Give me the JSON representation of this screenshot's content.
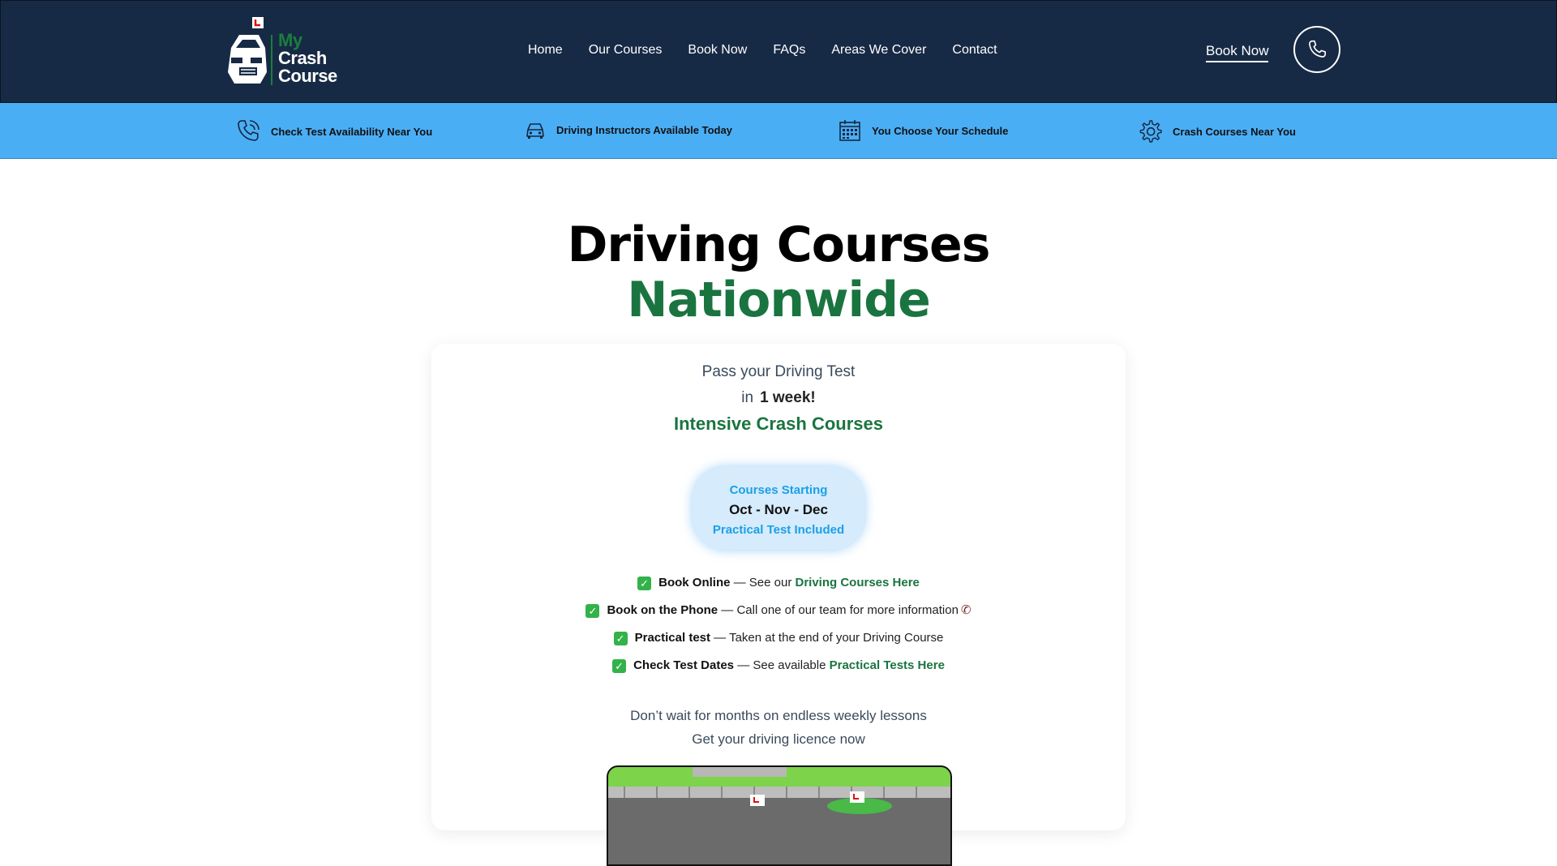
{
  "header": {
    "logo": {
      "line1": "My",
      "line2": "Crash",
      "line3": "Course"
    },
    "nav": [
      "Home",
      "Our Courses",
      "Book Now",
      "FAQs",
      "Areas We Cover",
      "Contact"
    ],
    "book_now": "Book Now",
    "colors": {
      "background": "#172a45",
      "accent": "#1a7f3c"
    }
  },
  "features": [
    {
      "icon": "phone-icon",
      "label": "Check Test Availability Near You"
    },
    {
      "icon": "car-icon",
      "label": "Driving Instructors Available Today"
    },
    {
      "icon": "calendar-icon",
      "label": "You Choose Your Schedule"
    },
    {
      "icon": "gear-icon",
      "label": "Crash Courses Near You"
    }
  ],
  "hero": {
    "title_line1": "Driving Courses",
    "title_line2": "Nationwide"
  },
  "card": {
    "pass": "Pass your Driving Test",
    "in": "in",
    "week": "1 week!",
    "intensive": "Intensive Crash Courses",
    "badge": {
      "line1": "Courses Starting",
      "line2": "Oct - Nov - Dec",
      "line3": "Practical Test Included"
    },
    "checks": [
      {
        "bold": "Book Online",
        "text": " — See our ",
        "link": "Driving Courses Here"
      },
      {
        "bold": "Book on the Phone",
        "text": " — Call one of our team for more information",
        "link": ""
      },
      {
        "bold": "Practical test",
        "text": " — Taken at the end of your Driving Course",
        "link": ""
      },
      {
        "bold": "Check Test Dates",
        "text": " — See available ",
        "link": "Practical Tests Here"
      }
    ],
    "dont_line1": "Don’t wait for months on endless weekly lessons",
    "dont_line2": "Get your driving licence now"
  }
}
